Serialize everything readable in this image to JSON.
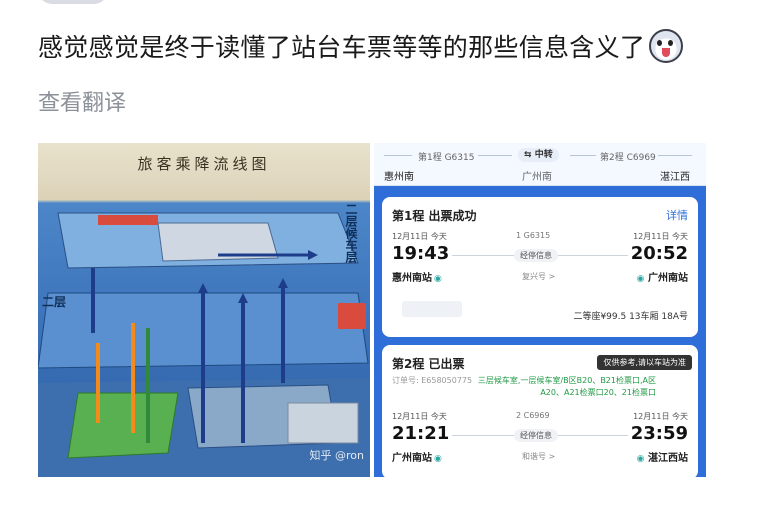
{
  "post": {
    "text": "感觉感觉是终于读懂了站台车票等等的那些信息含义了",
    "translate_link": "查看翻译"
  },
  "map_image": {
    "title": "旅客乘降流线图",
    "side_label": "二层候车层",
    "floor_label": "二层",
    "watermark": "知乎 @ron"
  },
  "ticket_image": {
    "route": {
      "leg1": "第1程 G6315",
      "transfer": "中转",
      "leg2": "第2程 C6969",
      "origin": "惠州南",
      "transfer_city": "广州南",
      "destination": "湛江西"
    },
    "card1": {
      "title": "第1程 出票成功",
      "detail_link": "详情",
      "dep_date": "12月11日 今天",
      "arr_date": "12月11日 今天",
      "train_no": "1 G6315",
      "dep_time": "19:43",
      "arr_time": "20:52",
      "stops_label": "经停信息",
      "dep_station": "惠州南站",
      "arr_station": "广州南站",
      "extra_link": "复兴号 >",
      "seat": "二等座¥99.5  13车厢 18A号"
    },
    "card2": {
      "title": "第2程 已出票",
      "tooltip": "仅供参考,请以车站为准",
      "order_no": "订单号: E658050775",
      "gate_info": "三层候车室,一层候车室/B区B20、B21检票口,A区A20、A21检票口20、21检票口",
      "dep_date": "12月11日 今天",
      "arr_date": "12月11日 今天",
      "train_no": "2 C6969",
      "dep_time": "21:21",
      "arr_time": "23:59",
      "stops_label": "经停信息",
      "dep_station": "广州南站",
      "arr_station": "湛江西站",
      "extra_link": "和谐号 >"
    }
  }
}
